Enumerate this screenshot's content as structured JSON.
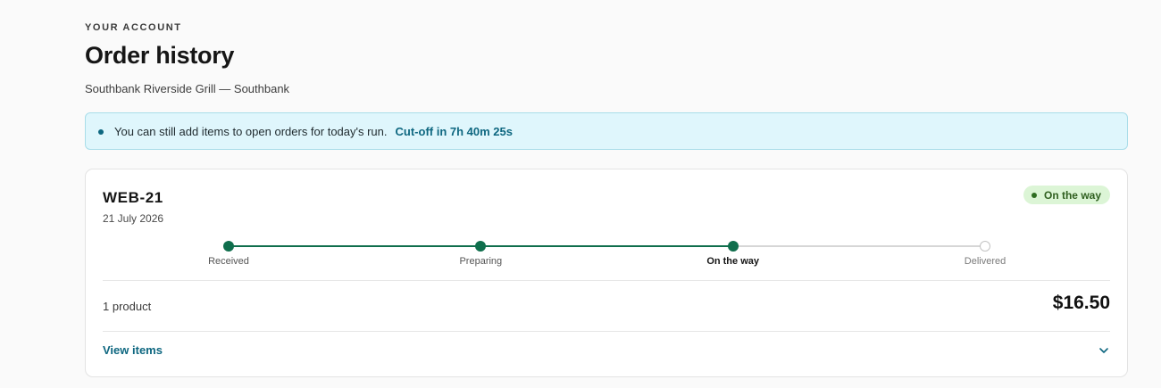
{
  "header": {
    "eyebrow": "YOUR ACCOUNT",
    "title": "Order history",
    "subtitle": "Southbank Riverside Grill — Southbank"
  },
  "notice": {
    "message": "You can still add items to open orders for today's run.",
    "cutoff": "Cut-off in 7h 40m 25s"
  },
  "order": {
    "id": "WEB-21",
    "date": "21 July 2026",
    "status": "On the way",
    "steps": [
      {
        "label": "Received",
        "state": "done"
      },
      {
        "label": "Preparing",
        "state": "done"
      },
      {
        "label": "On the way",
        "state": "current"
      },
      {
        "label": "Delivered",
        "state": "todo"
      }
    ],
    "product_count": "1 product",
    "total": "$16.50",
    "view_items_label": "View items"
  },
  "colors": {
    "brand_green": "#0f6e4c",
    "link_teal": "#0e6780",
    "notice_bg": "#dff6fc",
    "badge_bg": "#dcf5d6"
  },
  "icons": {
    "notice": "info-dot-icon",
    "status": "status-dot-icon",
    "expand": "chevron-down-icon"
  }
}
